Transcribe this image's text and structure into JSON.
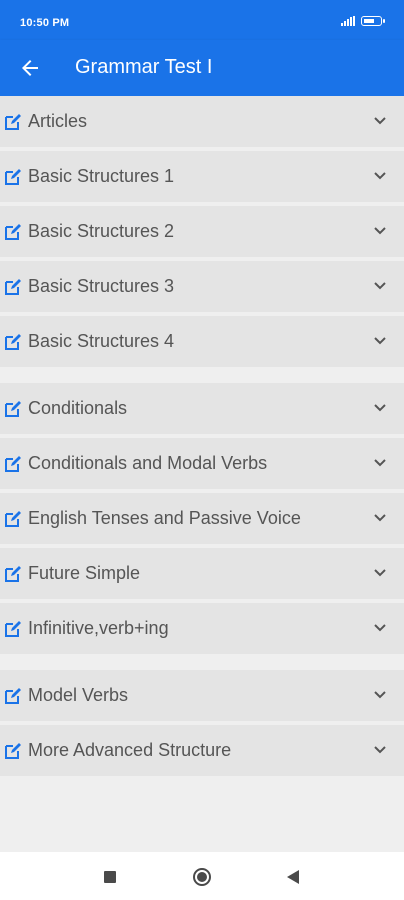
{
  "status_bar": {
    "time": "10:50 PM"
  },
  "app_bar": {
    "title": "Grammar Test I"
  },
  "groups": [
    {
      "items": [
        {
          "label": "Articles"
        },
        {
          "label": "Basic Structures 1"
        },
        {
          "label": "Basic Structures 2"
        },
        {
          "label": "Basic Structures 3"
        },
        {
          "label": "Basic Structures 4"
        }
      ]
    },
    {
      "items": [
        {
          "label": "Conditionals"
        },
        {
          "label": "Conditionals and Modal Verbs"
        },
        {
          "label": "English Tenses and Passive Voice"
        },
        {
          "label": "Future Simple"
        },
        {
          "label": "Infinitive,verb+ing"
        }
      ]
    },
    {
      "items": [
        {
          "label": "Model Verbs"
        },
        {
          "label": "More Advanced Structure"
        }
      ]
    }
  ],
  "colors": {
    "accent": "#1a73e8",
    "item_bg": "#e4e4e4",
    "page_bg": "#efefef"
  },
  "icons": {
    "back": "arrow-left-icon",
    "edit": "edit-icon",
    "expand": "chevron-down-icon"
  }
}
